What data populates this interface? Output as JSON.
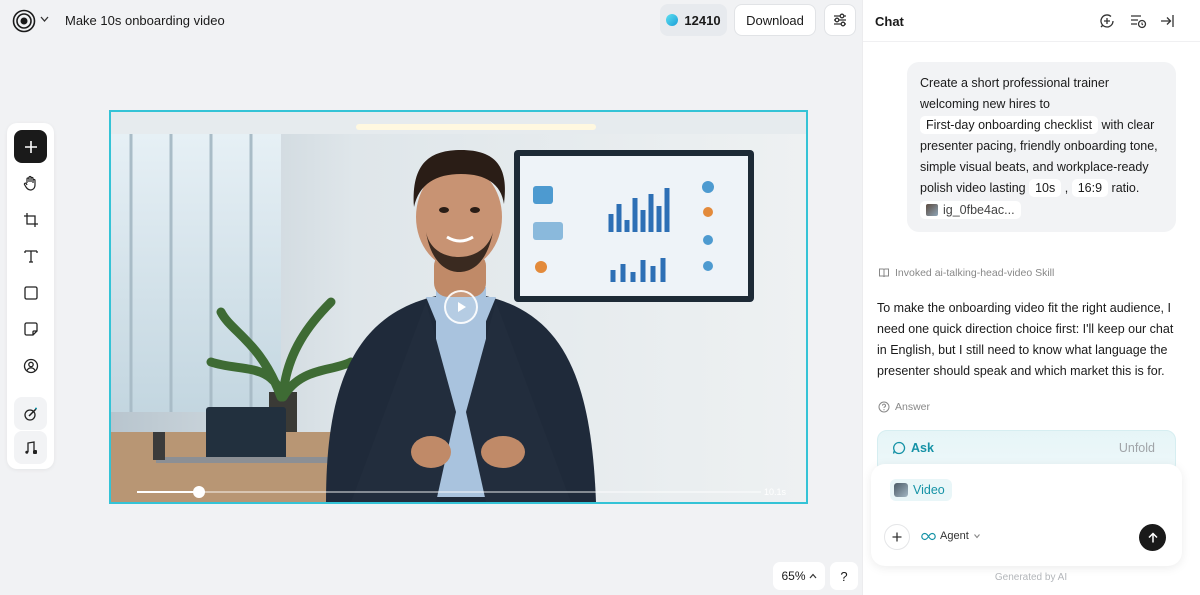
{
  "header": {
    "project_title": "Make 10s onboarding video",
    "credits": "12410",
    "download_label": "Download"
  },
  "toolbar": {
    "tools": [
      "add",
      "hand",
      "crop",
      "text",
      "rectangle",
      "sticky-note",
      "avatar",
      "brush-magic",
      "music-note"
    ]
  },
  "canvas": {
    "duration": "10.1s",
    "progress": 0.1,
    "zoom": "65%",
    "zoom_chevron": "^",
    "help": "?"
  },
  "chat": {
    "title": "Chat",
    "user_message": {
      "line1": "Create a short professional trainer",
      "line2": "welcoming new hires to",
      "chip_topic": "First-day onboarding checklist",
      "line3": "with clear",
      "line4": "presenter pacing, friendly onboarding tone,",
      "line5": "simple visual beats, and workplace-ready",
      "line6": "polish video lasting",
      "chip_duration": "10s",
      "comma": ",",
      "chip_ratio": "16:9",
      "line7": "ratio.",
      "ref_image": "ig_0fbe4ac..."
    },
    "skill_line": "Invoked ai-talking-head-video Skill",
    "assistant_message": "To make the onboarding video fit the right audience, I need one quick direction choice first: I'll keep our chat in English, but I still need to know what language the presenter should speak and which market this is for.",
    "answer_label": "Answer",
    "ask_label": "Ask",
    "unfold_label": "Unfold",
    "composer": {
      "chip_label": "Video",
      "agent_label": "Agent"
    },
    "footer_note": "Generated by AI"
  },
  "colors": {
    "accent": "#1592a6",
    "frame_border": "#34c3d6",
    "background": "#f1f2f4"
  }
}
